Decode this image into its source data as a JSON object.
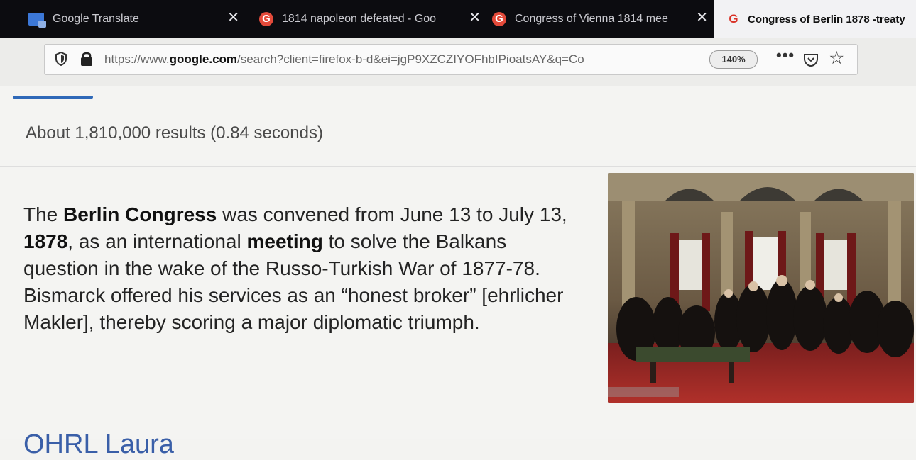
{
  "browser": {
    "tabs": [
      {
        "title": "Google Translate",
        "icon": "google-translate-icon",
        "close": "✕",
        "active": false
      },
      {
        "title": "1814 napoleon defeated - Goo",
        "icon": "google-icon",
        "close": "✕",
        "active": false
      },
      {
        "title": "Congress of Vienna 1814 mee",
        "icon": "google-icon",
        "close": "✕",
        "active": false
      },
      {
        "title": "Congress of Berlin 1878 -treaty",
        "icon": "google-icon",
        "active": true
      }
    ],
    "url": {
      "prefix": "https://www.",
      "domain": "google.com",
      "path": "/search?client=firefox-b-d&ei=jgP9XZCZIYOFhbIPioatsAY&q=Co"
    },
    "zoom": "140%",
    "toolbar": {
      "more": "•••"
    }
  },
  "results": {
    "stats": "About 1,810,000 results (0.84 seconds)",
    "snippet": [
      {
        "text": "The ",
        "bold": false
      },
      {
        "text": "Berlin Congress",
        "bold": true
      },
      {
        "text": " was convened from June 13 to July 13, ",
        "bold": false
      },
      {
        "text": "1878",
        "bold": true
      },
      {
        "text": ", as an international ",
        "bold": false
      },
      {
        "text": "meeting",
        "bold": true
      },
      {
        "text": " to solve the Balkans question in the wake of the Russo-Turkish War of 1877-78. Bismarck offered his services as an “honest broker” [ehrlicher Makler], thereby scoring a major diplomatic triumph.",
        "bold": false
      }
    ],
    "next_heading": "OHRL Laura"
  },
  "colors": {
    "tabbar": "#0c0c10",
    "accent": "#2f69b8",
    "link": "#3a5fa8"
  }
}
